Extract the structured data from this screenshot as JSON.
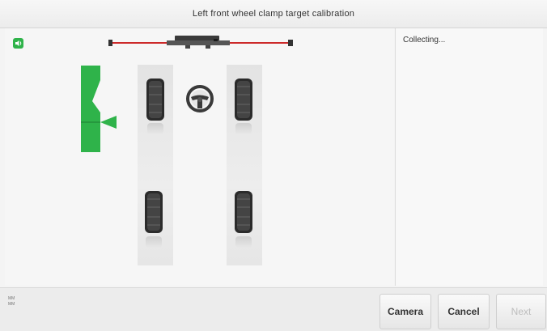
{
  "window": {
    "title": "Left front wheel clamp target calibration"
  },
  "side_panel": {
    "status": "Collecting..."
  },
  "footer": {
    "unit_lines": [
      "MM",
      "MM"
    ],
    "buttons": {
      "camera": "Camera",
      "cancel": "Cancel",
      "next": "Next"
    }
  },
  "icons": {
    "sound": "speaker-icon",
    "steering": "steering-wheel-icon",
    "beam": "wheel-clamp-target-beam-icon"
  },
  "colors": {
    "accent_green": "#2fb34a",
    "beam_red": "#cc2a2a",
    "disabled_text": "#bdbdbd"
  }
}
